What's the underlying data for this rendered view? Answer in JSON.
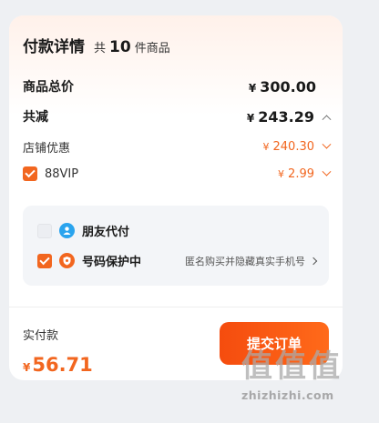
{
  "header": {
    "title": "付款详情",
    "count_prefix": "共",
    "count": "10",
    "count_suffix": "件商品"
  },
  "summary": {
    "subtotal_label": "商品总价",
    "subtotal_currency": "¥",
    "subtotal_value": "300.00",
    "discount_label": "共减",
    "discount_currency": "¥",
    "discount_value": "243.29"
  },
  "discounts": [
    {
      "label": "店铺优惠",
      "currency": "¥",
      "value": "240.30"
    },
    {
      "label": "88VIP",
      "currency": "¥",
      "value": "2.99",
      "checked": true
    }
  ],
  "options": [
    {
      "label": "朋友代付",
      "checked": false,
      "icon": "person-icon"
    },
    {
      "label": "号码保护中",
      "checked": true,
      "icon": "phone-shield-icon",
      "detail": "匿名购买并隐藏真实手机号"
    }
  ],
  "footer": {
    "pay_label": "实付款",
    "pay_currency": "¥",
    "pay_value": "56.71",
    "submit_label": "提交订单"
  },
  "watermark": {
    "chars": [
      "值",
      "值",
      "值"
    ],
    "text": "zhizhizhi.com"
  },
  "colors": {
    "accent": "#f2661f",
    "background": "#eef0f3",
    "panel": "#f3f5f8"
  }
}
